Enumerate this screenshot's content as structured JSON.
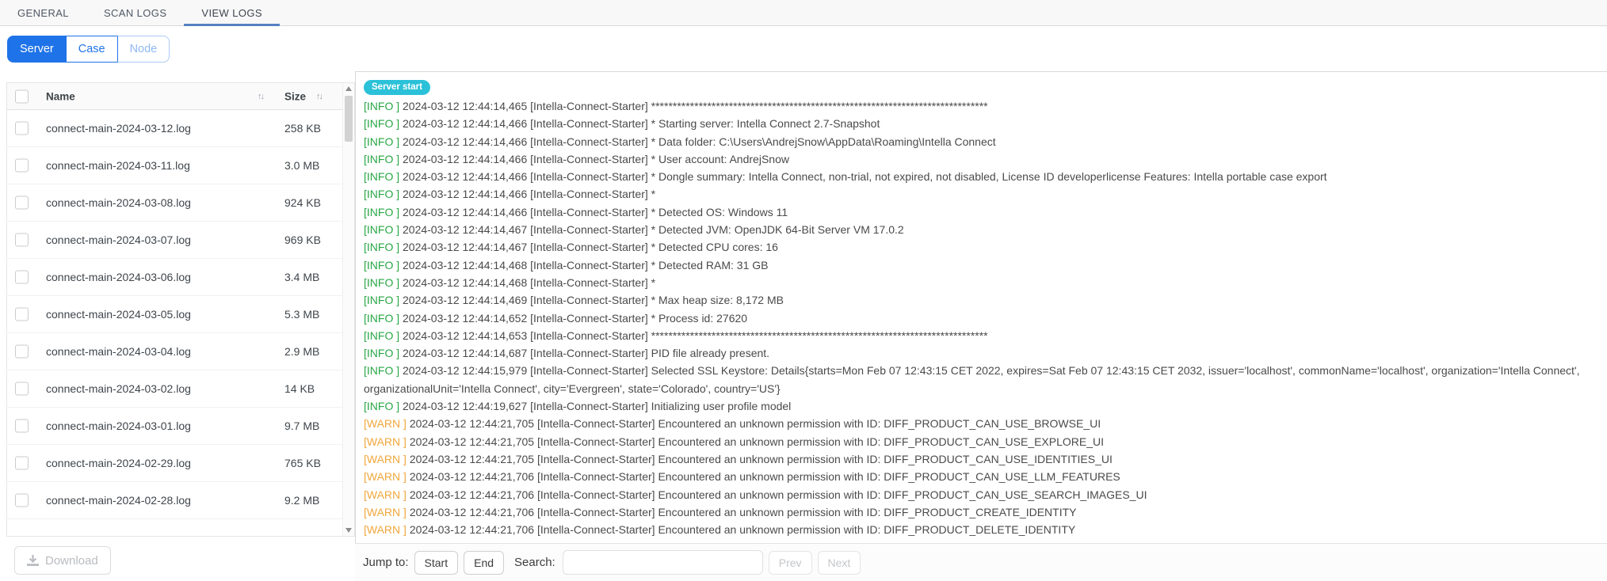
{
  "tabs": {
    "items": [
      {
        "label": "GENERAL",
        "active": false
      },
      {
        "label": "SCAN LOGS",
        "active": false
      },
      {
        "label": "VIEW LOGS",
        "active": true
      }
    ]
  },
  "source_toggle": {
    "options": [
      {
        "label": "Server",
        "state": "selected"
      },
      {
        "label": "Case",
        "state": "available"
      },
      {
        "label": "Node",
        "state": "disabled"
      }
    ]
  },
  "file_panel": {
    "columns": {
      "name": "Name",
      "size": "Size"
    },
    "sort_icon": "↑↓",
    "rows": [
      {
        "name": "connect-main-2024-03-12.log",
        "size": "258 KB"
      },
      {
        "name": "connect-main-2024-03-11.log",
        "size": "3.0 MB"
      },
      {
        "name": "connect-main-2024-03-08.log",
        "size": "924 KB"
      },
      {
        "name": "connect-main-2024-03-07.log",
        "size": "969 KB"
      },
      {
        "name": "connect-main-2024-03-06.log",
        "size": "3.4 MB"
      },
      {
        "name": "connect-main-2024-03-05.log",
        "size": "5.3 MB"
      },
      {
        "name": "connect-main-2024-03-04.log",
        "size": "2.9 MB"
      },
      {
        "name": "connect-main-2024-03-02.log",
        "size": "14 KB"
      },
      {
        "name": "connect-main-2024-03-01.log",
        "size": "9.7 MB"
      },
      {
        "name": "connect-main-2024-02-29.log",
        "size": "765 KB"
      },
      {
        "name": "connect-main-2024-02-28.log",
        "size": "9.2 MB"
      }
    ],
    "download_label": "Download"
  },
  "log_viewer": {
    "badge": "Server start",
    "lines": [
      {
        "level": "INFO",
        "text": "2024-03-12 12:44:14,465 [Intella-Connect-Starter] ******************************************************************************"
      },
      {
        "level": "INFO",
        "text": "2024-03-12 12:44:14,466 [Intella-Connect-Starter] * Starting server: Intella Connect 2.7-Snapshot"
      },
      {
        "level": "INFO",
        "text": "2024-03-12 12:44:14,466 [Intella-Connect-Starter] * Data folder: C:\\Users\\AndrejSnow\\AppData\\Roaming\\Intella Connect"
      },
      {
        "level": "INFO",
        "text": "2024-03-12 12:44:14,466 [Intella-Connect-Starter] * User account: AndrejSnow"
      },
      {
        "level": "INFO",
        "text": "2024-03-12 12:44:14,466 [Intella-Connect-Starter] * Dongle summary: Intella Connect, non-trial, not expired, not disabled, License ID developerlicense Features: Intella portable case export"
      },
      {
        "level": "INFO",
        "text": "2024-03-12 12:44:14,466 [Intella-Connect-Starter] *"
      },
      {
        "level": "INFO",
        "text": "2024-03-12 12:44:14,466 [Intella-Connect-Starter] * Detected OS: Windows 11"
      },
      {
        "level": "INFO",
        "text": "2024-03-12 12:44:14,467 [Intella-Connect-Starter] * Detected JVM: OpenJDK 64-Bit Server VM 17.0.2"
      },
      {
        "level": "INFO",
        "text": "2024-03-12 12:44:14,467 [Intella-Connect-Starter] * Detected CPU cores: 16"
      },
      {
        "level": "INFO",
        "text": "2024-03-12 12:44:14,468 [Intella-Connect-Starter] * Detected RAM: 31 GB"
      },
      {
        "level": "INFO",
        "text": "2024-03-12 12:44:14,468 [Intella-Connect-Starter] *"
      },
      {
        "level": "INFO",
        "text": "2024-03-12 12:44:14,469 [Intella-Connect-Starter] * Max heap size: 8,172 MB"
      },
      {
        "level": "INFO",
        "text": "2024-03-12 12:44:14,652 [Intella-Connect-Starter] * Process id: 27620"
      },
      {
        "level": "INFO",
        "text": "2024-03-12 12:44:14,653 [Intella-Connect-Starter] ******************************************************************************"
      },
      {
        "level": "INFO",
        "text": "2024-03-12 12:44:14,687 [Intella-Connect-Starter] PID file already present."
      },
      {
        "level": "INFO",
        "text": "2024-03-12 12:44:15,979 [Intella-Connect-Starter] Selected SSL Keystore: Details{starts=Mon Feb 07 12:43:15 CET 2022, expires=Sat Feb 07 12:43:15 CET 2032, issuer='localhost', commonName='localhost', organization='Intella Connect',"
      },
      {
        "level": null,
        "text": "organizationalUnit='Intella Connect', city='Evergreen', state='Colorado', country='US'}"
      },
      {
        "level": "INFO",
        "text": "2024-03-12 12:44:19,627 [Intella-Connect-Starter] Initializing user profile model"
      },
      {
        "level": "WARN",
        "text": "2024-03-12 12:44:21,705 [Intella-Connect-Starter] Encountered an unknown permission with ID: DIFF_PRODUCT_CAN_USE_BROWSE_UI"
      },
      {
        "level": "WARN",
        "text": "2024-03-12 12:44:21,705 [Intella-Connect-Starter] Encountered an unknown permission with ID: DIFF_PRODUCT_CAN_USE_EXPLORE_UI"
      },
      {
        "level": "WARN",
        "text": "2024-03-12 12:44:21,705 [Intella-Connect-Starter] Encountered an unknown permission with ID: DIFF_PRODUCT_CAN_USE_IDENTITIES_UI"
      },
      {
        "level": "WARN",
        "text": "2024-03-12 12:44:21,706 [Intella-Connect-Starter] Encountered an unknown permission with ID: DIFF_PRODUCT_CAN_USE_LLM_FEATURES"
      },
      {
        "level": "WARN",
        "text": "2024-03-12 12:44:21,706 [Intella-Connect-Starter] Encountered an unknown permission with ID: DIFF_PRODUCT_CAN_USE_SEARCH_IMAGES_UI"
      },
      {
        "level": "WARN",
        "text": "2024-03-12 12:44:21,706 [Intella-Connect-Starter] Encountered an unknown permission with ID: DIFF_PRODUCT_CREATE_IDENTITY"
      },
      {
        "level": "WARN",
        "text": "2024-03-12 12:44:21,706 [Intella-Connect-Starter] Encountered an unknown permission with ID: DIFF_PRODUCT_DELETE_IDENTITY"
      }
    ]
  },
  "footer": {
    "jump_label": "Jump to:",
    "start_label": "Start",
    "end_label": "End",
    "search_label": "Search:",
    "search_value": "",
    "prev_label": "Prev",
    "next_label": "Next"
  },
  "colors": {
    "accent_blue": "#1f73e8",
    "tab_underline": "#5581c1",
    "info_green": "#28a745",
    "warn_orange": "#f0a73c",
    "badge_cyan": "#2bc1d8"
  }
}
